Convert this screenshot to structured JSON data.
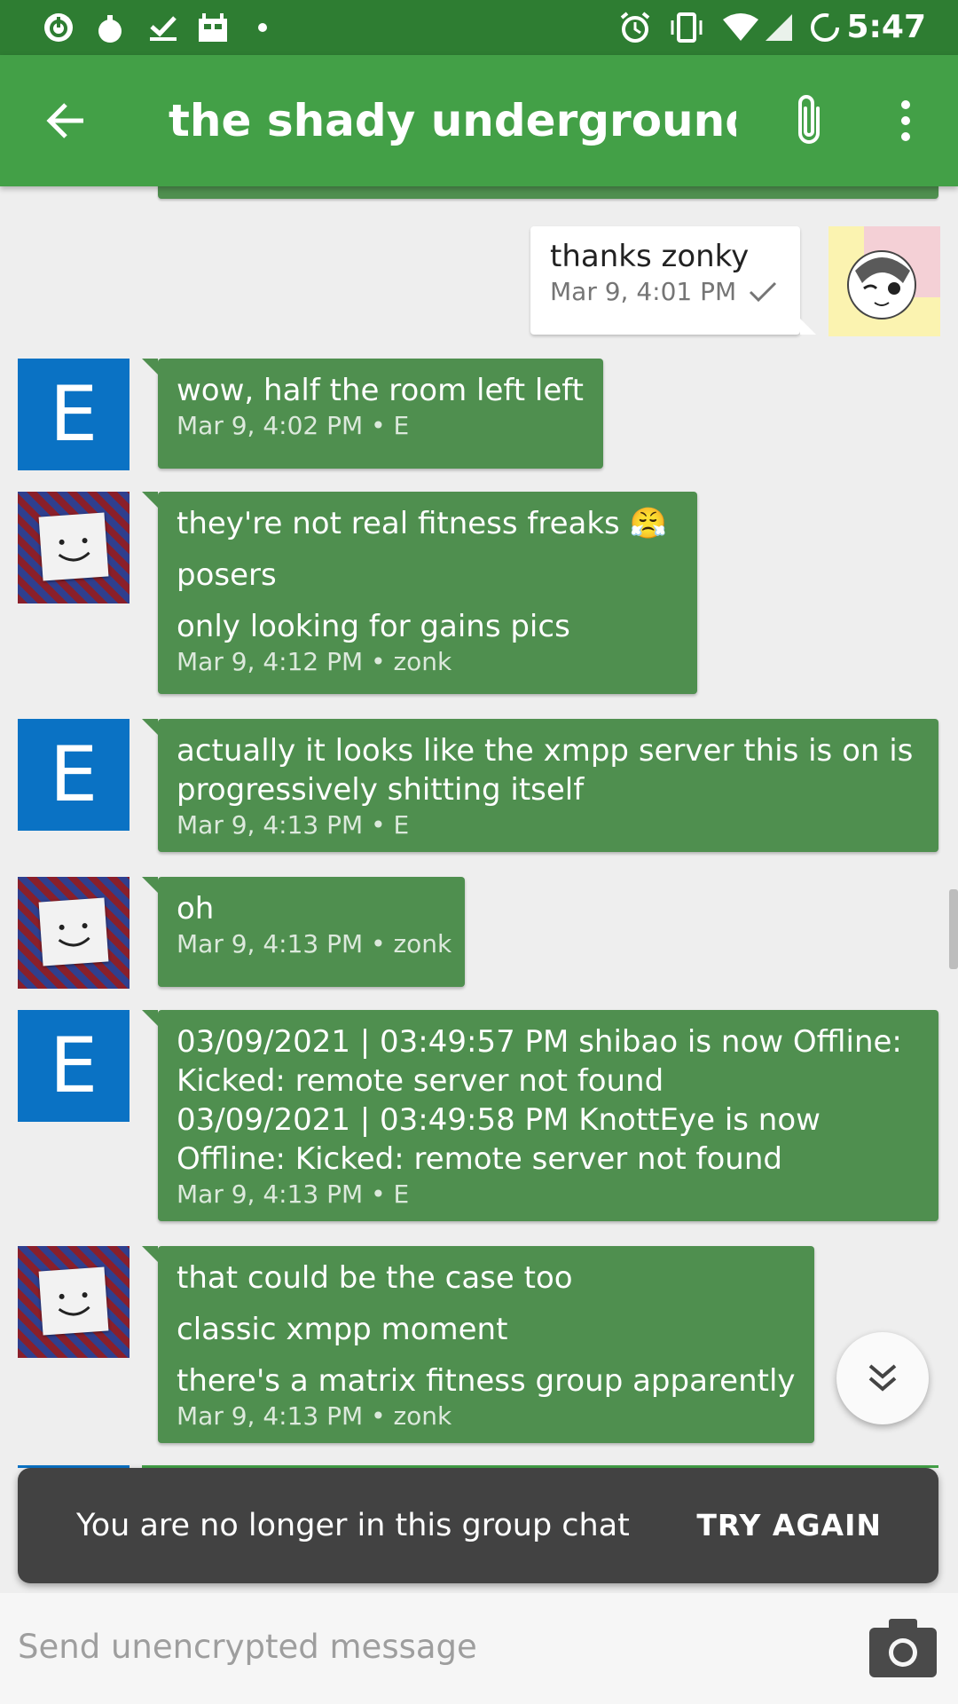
{
  "status_bar": {
    "time": "5:47",
    "icons": [
      "power-notify-icon",
      "bomb-icon",
      "check-icon",
      "android-icon",
      "dot-icon",
      "alarm-icon",
      "vibrate-icon",
      "wifi-icon",
      "signal-icon",
      "sync-icon"
    ]
  },
  "header": {
    "title": "the shady underground…",
    "colors": {
      "status_bar": "#2e7d32",
      "app_bar": "#43a047",
      "bubble": "#4f8f4f",
      "avatar_e": "#0a72c4"
    }
  },
  "messages": {
    "outgoing": {
      "text": "thanks zonky",
      "time": "Mar 9, 4:01 PM"
    },
    "incoming": [
      {
        "avatar": "E",
        "lines": [
          "wow, half the room left left"
        ],
        "meta": "Mar 9, 4:02 PM • E"
      },
      {
        "avatar": "zonk",
        "lines": [
          "they're not real fitness freaks 😤",
          "posers",
          "only looking for gains pics"
        ],
        "meta": "Mar 9, 4:12 PM • zonk"
      },
      {
        "avatar": "E",
        "lines": [
          "actually it looks like the xmpp server this is on is",
          "progressively shitting itself"
        ],
        "meta": "Mar 9, 4:13 PM • E"
      },
      {
        "avatar": "zonk",
        "lines": [
          "oh"
        ],
        "meta": "Mar 9, 4:13 PM • zonk"
      },
      {
        "avatar": "E",
        "lines": [
          "03/09/2021 | 03:49:57 PM  shibao is now Offline:",
          "Kicked: remote server not found",
          "03/09/2021 | 03:49:58 PM  KnottEye is now",
          "Offline: Kicked: remote server not found"
        ],
        "meta": "Mar 9, 4:13 PM • E"
      },
      {
        "avatar": "zonk",
        "lines": [
          "that could be the case too",
          "classic xmpp moment",
          "there's a matrix fitness group apparently"
        ],
        "meta": "Mar 9, 4:13 PM • zonk"
      }
    ]
  },
  "snackbar": {
    "text": "You are no longer in this group chat",
    "action": "TRY AGAIN"
  },
  "composer": {
    "placeholder": "Send unencrypted message",
    "value": ""
  }
}
